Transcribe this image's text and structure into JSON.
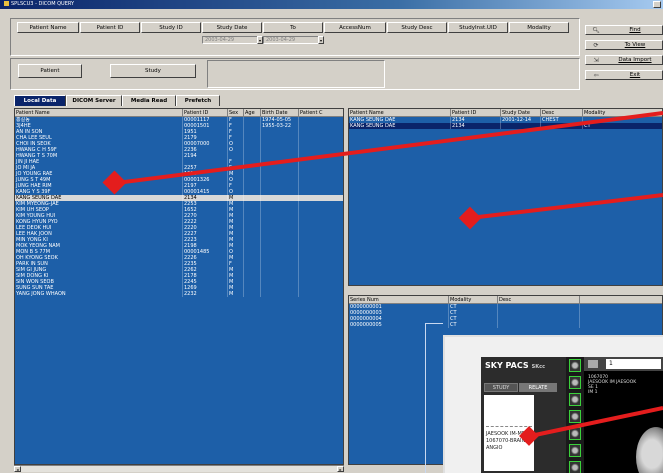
{
  "window": {
    "title": "SPLSCU3 - DICOM QUERY"
  },
  "query_headers": [
    "Patient Name",
    "Patient ID",
    "Study ID",
    "Study Date",
    "To",
    "AccessNum",
    "Study Desc",
    "StudyInst.UID",
    "Modality"
  ],
  "date_from": "2003-04-29",
  "date_to": "2003-04-29",
  "level_buttons": [
    "Patient",
    "Study"
  ],
  "side_buttons": [
    {
      "label": "Find",
      "icon": "magnifier-icon"
    },
    {
      "label": "To View",
      "icon": "view-icon"
    },
    {
      "label": "Data Import",
      "icon": "import-icon"
    },
    {
      "label": "Exit",
      "icon": "exit-icon"
    }
  ],
  "tabs": [
    "Local Data",
    "DICOM Server",
    "Media Read",
    "Prefetch"
  ],
  "patient_table": {
    "columns": [
      "Patient Name",
      "Patient ID",
      "Sex",
      "Age",
      "Birth Date",
      "Patient C"
    ],
    "rows": [
      [
        "홍길동",
        "00001117",
        "F",
        "",
        "1974-05-05",
        ""
      ],
      [
        "3J4HE",
        "00001501",
        "F",
        "",
        "1955-03-22",
        ""
      ],
      [
        "AN IN SON",
        "1951",
        "F",
        "",
        "",
        ""
      ],
      [
        "CHA LEE SEUL",
        "2179",
        "F",
        "",
        "",
        ""
      ],
      [
        "CHOI IN SEOK",
        "00007000",
        "O",
        "",
        "",
        ""
      ],
      [
        "HWANG C H 59F",
        "2236",
        "O",
        "",
        "",
        ""
      ],
      [
        "HWANG T S 70M",
        "2194",
        "",
        "",
        "",
        ""
      ],
      [
        "JIN JI HAE",
        "",
        "F",
        "",
        "",
        ""
      ],
      [
        "JO MI JA",
        "2257",
        "F",
        "",
        "",
        ""
      ],
      [
        "JO YOUNG RAE",
        "1018",
        "M",
        "",
        "",
        ""
      ],
      [
        "JUNG S T 49M",
        "00001326",
        "O",
        "",
        "",
        ""
      ],
      [
        "JUNG HAE RIM",
        "2197",
        "F",
        "",
        "",
        ""
      ],
      [
        "KANG Y S 39F",
        "00001415",
        "O",
        "",
        "",
        ""
      ],
      [
        "KANG SEUNG DAE",
        "2134",
        "M",
        "",
        "",
        ""
      ],
      [
        "KIM MYEONG-JAE",
        "2253",
        "M",
        "",
        "",
        ""
      ],
      [
        "KIM UH SEOP",
        "1652",
        "M",
        "",
        "",
        ""
      ],
      [
        "KIM YOUNG HUI",
        "2270",
        "M",
        "",
        "",
        ""
      ],
      [
        "KONG HYUN PYO",
        "2222",
        "M",
        "",
        "",
        ""
      ],
      [
        "LEE DEOK HUI",
        "2220",
        "M",
        "",
        "",
        ""
      ],
      [
        "LEE HAK JOON",
        "2227",
        "M",
        "",
        "",
        ""
      ],
      [
        "MIN YONG KI",
        "2223",
        "M",
        "",
        "",
        ""
      ],
      [
        "MOK YEONG NAM",
        "2198",
        "M",
        "",
        "",
        ""
      ],
      [
        "MON B S 77M",
        "00001485",
        "O",
        "",
        "",
        ""
      ],
      [
        "OH KYONG SEOK",
        "2226",
        "M",
        "",
        "",
        ""
      ],
      [
        "PARK IN SUN",
        "2235",
        "F",
        "",
        "",
        ""
      ],
      [
        "SIM GI JUNG",
        "2262",
        "M",
        "",
        "",
        ""
      ],
      [
        "SIM DONG KI",
        "2178",
        "M",
        "",
        "",
        ""
      ],
      [
        "SIN WON SEOB",
        "2245",
        "M",
        "",
        "",
        ""
      ],
      [
        "SUNG SUN TAE",
        "1269",
        "M",
        "",
        "",
        ""
      ],
      [
        "YANG JONG WHAON",
        "2232",
        "M",
        "",
        "",
        ""
      ]
    ],
    "selected_index": 13
  },
  "study_table": {
    "columns": [
      "Patient Name",
      "Patient ID",
      "Study Date",
      "Desc",
      "Modality"
    ],
    "rows": [
      [
        "KANG SEUNG DAE",
        "2134",
        "2001-12-14",
        "CHEST",
        ""
      ],
      [
        "KANG SEUNG DAE",
        "2134",
        "",
        "",
        "CT"
      ]
    ]
  },
  "series_table": {
    "columns": [
      "Series Num",
      "Modality",
      "Desc"
    ],
    "rows": [
      [
        "0000000001",
        "CT",
        ""
      ],
      [
        "0000000003",
        "CT",
        ""
      ],
      [
        "0000000004",
        "CT",
        ""
      ],
      [
        "0000000005",
        "CT",
        ""
      ]
    ]
  },
  "viewer": {
    "logo": "SKY PACS",
    "logo_sub": "SKcc",
    "tabs": [
      "STUDY",
      "RELATE"
    ],
    "info_lines": [
      "JAESOOK IM-MR",
      "1067070-BRAIN",
      "ANGIO"
    ],
    "page_field": "1",
    "overlay_text": [
      "1067070",
      "JAESOOK IM JAESOOK",
      "SE 1",
      "IM 1"
    ]
  },
  "colors": {
    "grid_bg": "#1d5fa8",
    "selection": "#0a246a",
    "marker": "#e41d1d",
    "thumb_border": "#3bd13b"
  }
}
